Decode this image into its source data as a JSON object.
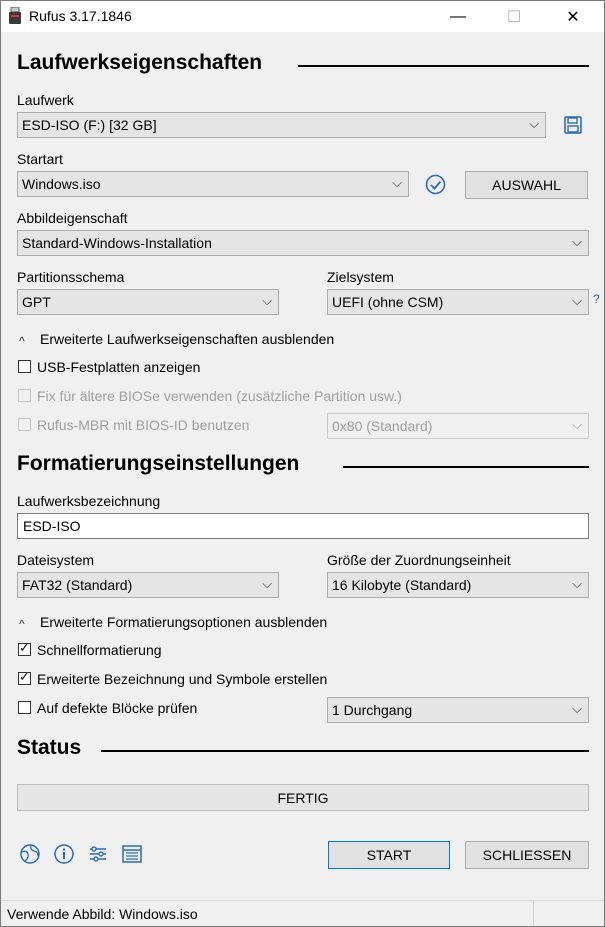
{
  "window": {
    "title": "Rufus 3.17.1846",
    "minimize": "—",
    "maximize": "☐",
    "close": "✕"
  },
  "drive_props": {
    "heading": "Laufwerkseigenschaften",
    "device_label": "Laufwerk",
    "device_value": "ESD-ISO (F:) [32 GB]",
    "boot_label": "Startart",
    "boot_value": "Windows.iso",
    "select_button": "AUSWAHL",
    "image_option_label": "Abbildeigenschaft",
    "image_option_value": "Standard-Windows-Installation",
    "partition_label": "Partitionsschema",
    "partition_value": "GPT",
    "target_label": "Zielsystem",
    "target_value": "UEFI (ohne CSM)",
    "help": "?",
    "advanced_toggle": "Erweiterte Laufwerkseigenschaften ausblenden",
    "usb_hdd": "USB-Festplatten anzeigen",
    "old_bios": "Fix für ältere BIOSe verwenden (zusätzliche Partition usw.)",
    "rufus_mbr": "Rufus-MBR mit BIOS-ID benutzen",
    "bios_id_value": "0x80 (Standard)"
  },
  "format_opts": {
    "heading": "Formatierungseinstellungen",
    "volume_label": "Laufwerksbezeichnung",
    "volume_value": "ESD-ISO",
    "fs_label": "Dateisystem",
    "fs_value": "FAT32 (Standard)",
    "cluster_label": "Größe der Zuordnungseinheit",
    "cluster_value": "16 Kilobyte (Standard)",
    "advanced_toggle": "Erweiterte Formatierungsoptionen ausblenden",
    "quick_format": "Schnellformatierung",
    "extended_label": "Erweiterte Bezeichnung und Symbole erstellen",
    "bad_blocks": "Auf defekte Blöcke prüfen",
    "passes_value": "1 Durchgang"
  },
  "status": {
    "heading": "Status",
    "progress_text": "FERTIG",
    "start_button": "START",
    "close_button": "SCHLIESSEN",
    "statusbar_text": "Verwende Abbild: Windows.iso"
  },
  "chevron": "⌵",
  "check": "✓",
  "caret_up": "^",
  "colors": {
    "accent": "#0078d7",
    "background": "#f0f0f0"
  }
}
